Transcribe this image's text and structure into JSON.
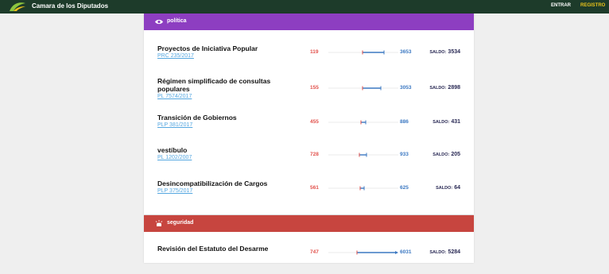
{
  "header": {
    "app_title": "Camara de los Diputados",
    "nav": {
      "enter": "ENTRAR",
      "register": "REGISTRO"
    }
  },
  "colors": {
    "topbar": "#1d3b2a",
    "politica": "#8d3ec1",
    "seguridad": "#c7453f",
    "against": "#e2524c",
    "favor": "#3b78c2",
    "register": "#e8c21a"
  },
  "sections": [
    {
      "name": "política",
      "icon": "eye-icon",
      "items": [
        {
          "title": "Proyectos de Iniciativa Popular",
          "code": "PRC 235/2017",
          "against": "119",
          "favor": "3653",
          "balance_label": "SALDO:",
          "balance": "3534"
        },
        {
          "title": "Régimen simplificado de consultas populares",
          "code": "PL 7574/2017",
          "against": "155",
          "favor": "3053",
          "balance_label": "SALDO:",
          "balance": "2898"
        },
        {
          "title": "Transición de Gobiernos",
          "code": "PLP 381/2017",
          "against": "455",
          "favor": "886",
          "balance_label": "SALDO:",
          "balance": "431"
        },
        {
          "title": "vestíbulo",
          "code": "PL 1202/2007",
          "against": "728",
          "favor": "933",
          "balance_label": "SALDO:",
          "balance": "205"
        },
        {
          "title": "Desincompatibilización de Cargos",
          "code": "PLP 375/2017",
          "against": "561",
          "favor": "625",
          "balance_label": "SALDO:",
          "balance": "64"
        }
      ]
    },
    {
      "name": "seguridad",
      "icon": "siren-icon",
      "items": [
        {
          "title": "Revisión del Estatuto del Desarme",
          "against": "747",
          "favor": "6031",
          "balance_label": "SALDO:",
          "balance": "5284"
        }
      ]
    }
  ]
}
